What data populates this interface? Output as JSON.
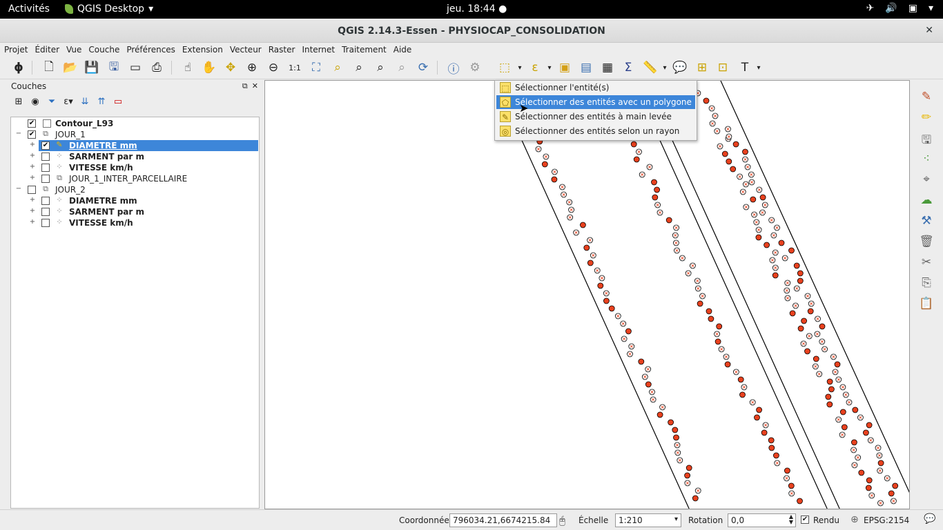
{
  "topbar": {
    "activities": "Activités",
    "app_name": "QGIS Desktop",
    "app_arrow": "▾",
    "clock": "jeu. 18:44 ●"
  },
  "window": {
    "title": "QGIS 2.14.3-Essen - PHYSIOCAP_CONSOLIDATION",
    "close": "✕"
  },
  "menus": [
    "Projet",
    "Éditer",
    "Vue",
    "Couche",
    "Préférences",
    "Extension",
    "Vecteur",
    "Raster",
    "Internet",
    "Traitement",
    "Aide"
  ],
  "toolbar_icons": [
    "gps-icon",
    "new-project-icon",
    "open-project-icon",
    "save-project-icon",
    "save-as-icon",
    "new-print-composer-icon",
    "composer-manager-icon",
    "touch-icon",
    "pan-icon",
    "pan-to-selection-icon",
    "zoom-in-icon",
    "zoom-out-icon",
    "zoom-native-icon",
    "zoom-full-icon",
    "zoom-to-selection-icon",
    "zoom-to-layer-icon",
    "zoom-last-icon",
    "zoom-next-icon",
    "refresh-icon",
    "identify-icon",
    "action-icon",
    "select-icon",
    "select-expression-icon",
    "deselect-icon",
    "attribute-table-icon",
    "statistics-icon",
    "sum-icon",
    "measure-icon",
    "map-tips-icon",
    "new-bookmark-icon",
    "show-bookmarks-icon",
    "text-annotation-icon"
  ],
  "layers_panel": {
    "title": "Couches",
    "tree": [
      {
        "label": "Contour_L93",
        "checked": true,
        "bold": true,
        "level": 0
      },
      {
        "label": "JOUR_1",
        "checked": true,
        "bold": false,
        "level": 0,
        "group": true
      },
      {
        "label": "DIAMETRE mm",
        "checked": true,
        "bold": true,
        "level": 1,
        "selected": true
      },
      {
        "label": "SARMENT par m",
        "checked": false,
        "bold": true,
        "level": 1
      },
      {
        "label": "VITESSE km/h",
        "checked": false,
        "bold": true,
        "level": 1
      },
      {
        "label": "JOUR_1_INTER_PARCELLAIRE",
        "checked": false,
        "bold": false,
        "level": 1,
        "group": true
      },
      {
        "label": "JOUR_2",
        "checked": false,
        "bold": false,
        "level": 0,
        "group": true
      },
      {
        "label": "DIAMETRE mm",
        "checked": false,
        "bold": true,
        "level": 1
      },
      {
        "label": "SARMENT par m",
        "checked": false,
        "bold": true,
        "level": 1
      },
      {
        "label": "VITESSE km/h",
        "checked": false,
        "bold": true,
        "level": 1
      }
    ]
  },
  "dropdown": {
    "items": [
      {
        "label": "Sélectionner l'entité(s)",
        "active": false
      },
      {
        "label": "Sélectionner des entités avec un polygone",
        "active": true
      },
      {
        "label": "Sélectionner des entités à main levée",
        "active": false
      },
      {
        "label": "Sélectionner des entités selon un rayon",
        "active": false
      }
    ]
  },
  "statusbar": {
    "coord_label": "Coordonnée",
    "coord_value": "796034.21,6674215.84",
    "scale_label": "Échelle",
    "scale_value": "1:210",
    "rotation_label": "Rotation",
    "rotation_value": "0,0",
    "render_label": "Rendu",
    "render_checked": true,
    "crs": "EPSG:2154"
  },
  "colors": {
    "selection": "#3d86d9",
    "point_fill": "#e8411e",
    "point_hollow": "#ffffff",
    "point_stroke": "#000000"
  }
}
